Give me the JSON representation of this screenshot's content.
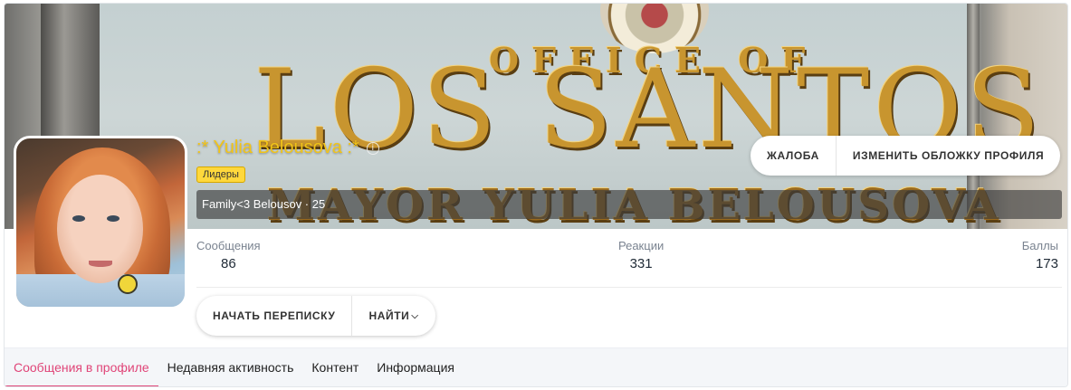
{
  "profile": {
    "username": ":* Yulia Belousova :*",
    "banner": "Лидеры",
    "custom_title": "Family<3 Belousov · 25",
    "colors": {
      "username": "#f2c418",
      "banner_bg": "#ffd83c",
      "accent": "#e04578"
    },
    "icons": {
      "info": "info-circle-icon",
      "dropdown": "chevron-down-icon"
    }
  },
  "cover": {
    "sign_line_1": "OFFICE OF",
    "sign_line_2": "LOS SANTOS",
    "sign_line_3": "MAYOR YULIA BELOUSOVA",
    "actions": {
      "report": "ЖАЛОБА",
      "change_cover": "ИЗМЕНИТЬ ОБЛОЖКУ ПРОФИЛЯ"
    }
  },
  "stats": {
    "messages": {
      "label": "Сообщения",
      "value": "86"
    },
    "reactions": {
      "label": "Реакции",
      "value": "331"
    },
    "points": {
      "label": "Баллы",
      "value": "173"
    }
  },
  "actions": {
    "start_conversation": "НАЧАТЬ ПЕРЕПИСКУ",
    "find": "НАЙТИ"
  },
  "tabs": [
    {
      "label": "Сообщения в профиле",
      "active": true
    },
    {
      "label": "Недавняя активность",
      "active": false
    },
    {
      "label": "Контент",
      "active": false
    },
    {
      "label": "Информация",
      "active": false
    }
  ]
}
